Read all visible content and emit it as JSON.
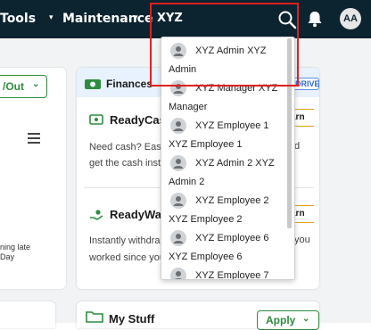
{
  "topbar": {
    "nav_items": [
      {
        "label": "Tools"
      },
      {
        "label": "Maintenance"
      }
    ],
    "search": {
      "value": "XYZ"
    },
    "avatar_initials": "AA",
    "colors": {
      "bar": "#0c2330",
      "highlight_box": "#e02020"
    }
  },
  "left_card": {
    "button_label": "/Out",
    "late_text": "ning late Day"
  },
  "finances": {
    "title": "Finances",
    "badge": "DRIVE",
    "readycash": {
      "title": "ReadyCas",
      "line1": "Need cash? Easi",
      "line2": "get the cash inst",
      "learn": "arn",
      "overflow": "d"
    },
    "readywage": {
      "title": "ReadyWag",
      "line1": "Instantly withdra",
      "line2": "worked since you",
      "learn": "arn",
      "overflow": "you"
    },
    "colors": {
      "accent": "#2e8b3e",
      "learn_border": "#e0a01c",
      "badge": "#2f6ad6"
    }
  },
  "my_stuff": {
    "title": "My Stuff",
    "apply_label": "Apply"
  },
  "dropdown": {
    "items": [
      {
        "name": "XYZ Admin XYZ Admin"
      },
      {
        "name": "XYZ Manager XYZ Manager"
      },
      {
        "name": "XYZ Employee 1 XYZ Employee 1"
      },
      {
        "name": "XYZ Admin 2 XYZ Admin 2"
      },
      {
        "name": "XYZ Employee 2 XYZ Employee 2"
      },
      {
        "name": "XYZ Employee 6 XYZ Employee 6"
      },
      {
        "name": "XYZ Employee 7"
      }
    ]
  }
}
